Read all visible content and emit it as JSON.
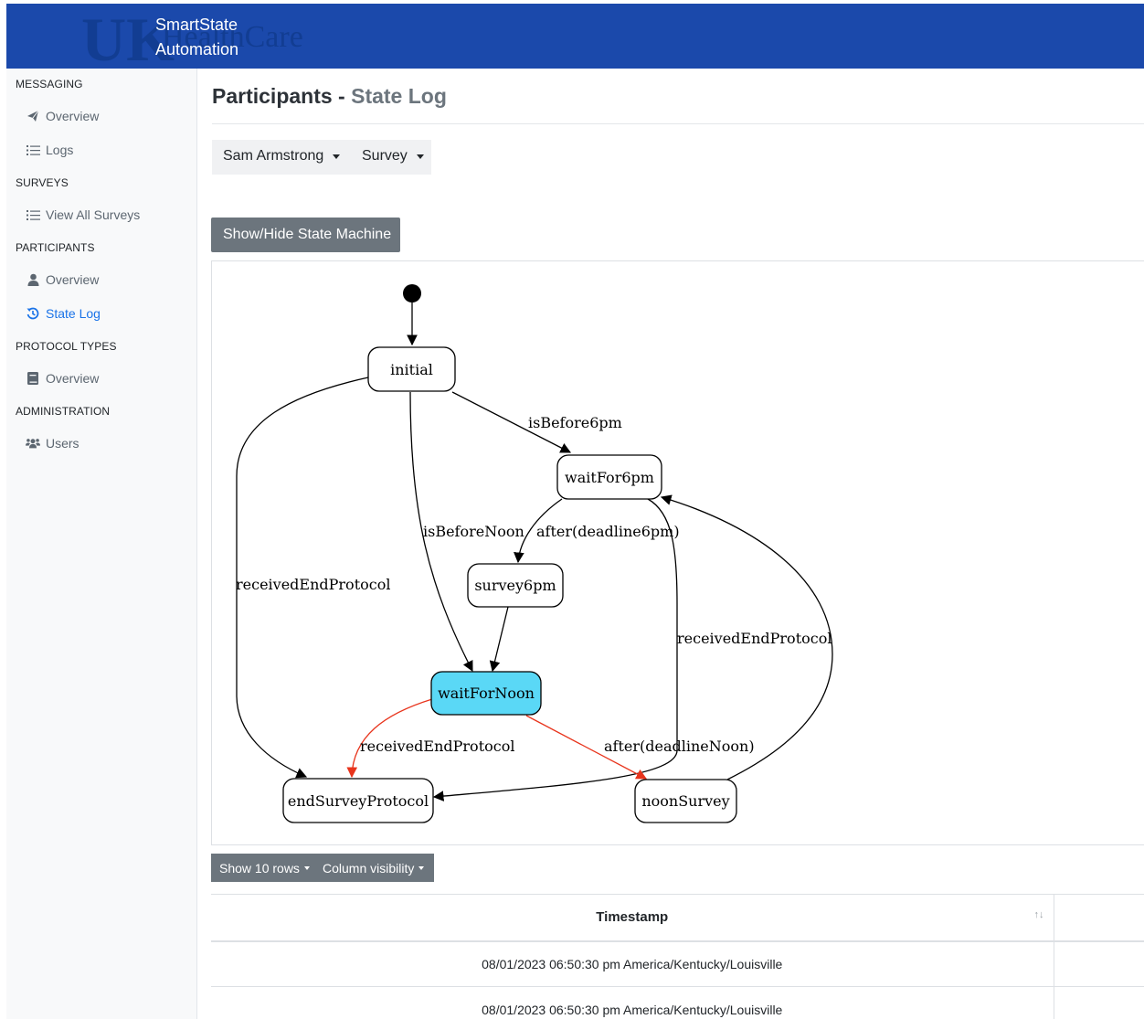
{
  "brand": {
    "line1": "SmartState",
    "line2": "Automation",
    "logo_letters": "UK",
    "logo_text": "HealthCare"
  },
  "sidebar": {
    "sections": [
      {
        "label": "MESSAGING"
      },
      {
        "label": "SURVEYS"
      },
      {
        "label": "PARTICIPANTS"
      },
      {
        "label": "PROTOCOL TYPES"
      },
      {
        "label": "ADMINISTRATION"
      }
    ],
    "items": [
      {
        "label": "Overview",
        "icon": "paper-plane-icon"
      },
      {
        "label": "Logs",
        "icon": "list-icon"
      },
      {
        "label": "View All Surveys",
        "icon": "list-icon"
      },
      {
        "label": "Overview",
        "icon": "user-icon"
      },
      {
        "label": "State Log",
        "icon": "history-icon",
        "active": true
      },
      {
        "label": "Overview",
        "icon": "book-icon"
      },
      {
        "label": "Users",
        "icon": "users-icon"
      }
    ]
  },
  "page": {
    "title": "Participants",
    "separator": " - ",
    "subtitle": "State Log"
  },
  "filters": {
    "participant": "Sam Armstrong",
    "type": "Survey"
  },
  "toggle_button": "Show/Hide State Machine",
  "state_machine": {
    "states": [
      "initial",
      "waitFor6pm",
      "survey6pm",
      "waitForNoon",
      "endSurveyProtocol",
      "noonSurvey"
    ],
    "current_state": "waitForNoon",
    "transitions": [
      {
        "from": "initial",
        "to": "waitFor6pm",
        "label": "isBefore6pm"
      },
      {
        "from": "initial",
        "to": "waitForNoon",
        "label": "isBeforeNoon"
      },
      {
        "from": "initial",
        "to": "endSurveyProtocol",
        "label": "receivedEndProtocol"
      },
      {
        "from": "waitFor6pm",
        "to": "survey6pm",
        "label": "after(deadline6pm)"
      },
      {
        "from": "waitFor6pm",
        "to": "endSurveyProtocol",
        "label": "receivedEndProtocol"
      },
      {
        "from": "survey6pm",
        "to": "waitForNoon",
        "label": ""
      },
      {
        "from": "waitForNoon",
        "to": "endSurveyProtocol",
        "label": "receivedEndProtocol"
      },
      {
        "from": "waitForNoon",
        "to": "noonSurvey",
        "label": "after(deadlineNoon)"
      },
      {
        "from": "noonSurvey",
        "to": "waitFor6pm",
        "label": ""
      }
    ],
    "colors": {
      "highlight_fill": "#5ad8f6",
      "active_edge": "#e8341c",
      "edge": "#000000"
    }
  },
  "table_controls": {
    "show_rows": "Show 10 rows",
    "column_visibility": "Column visibility"
  },
  "table": {
    "headers": [
      "Timestamp",
      ""
    ],
    "sort_icon": "↑↓",
    "rows": [
      [
        "08/01/2023 06:50:30 pm America/Kentucky/Louisville",
        ""
      ],
      [
        "08/01/2023 06:50:30 pm America/Kentucky/Louisville",
        ""
      ]
    ]
  }
}
